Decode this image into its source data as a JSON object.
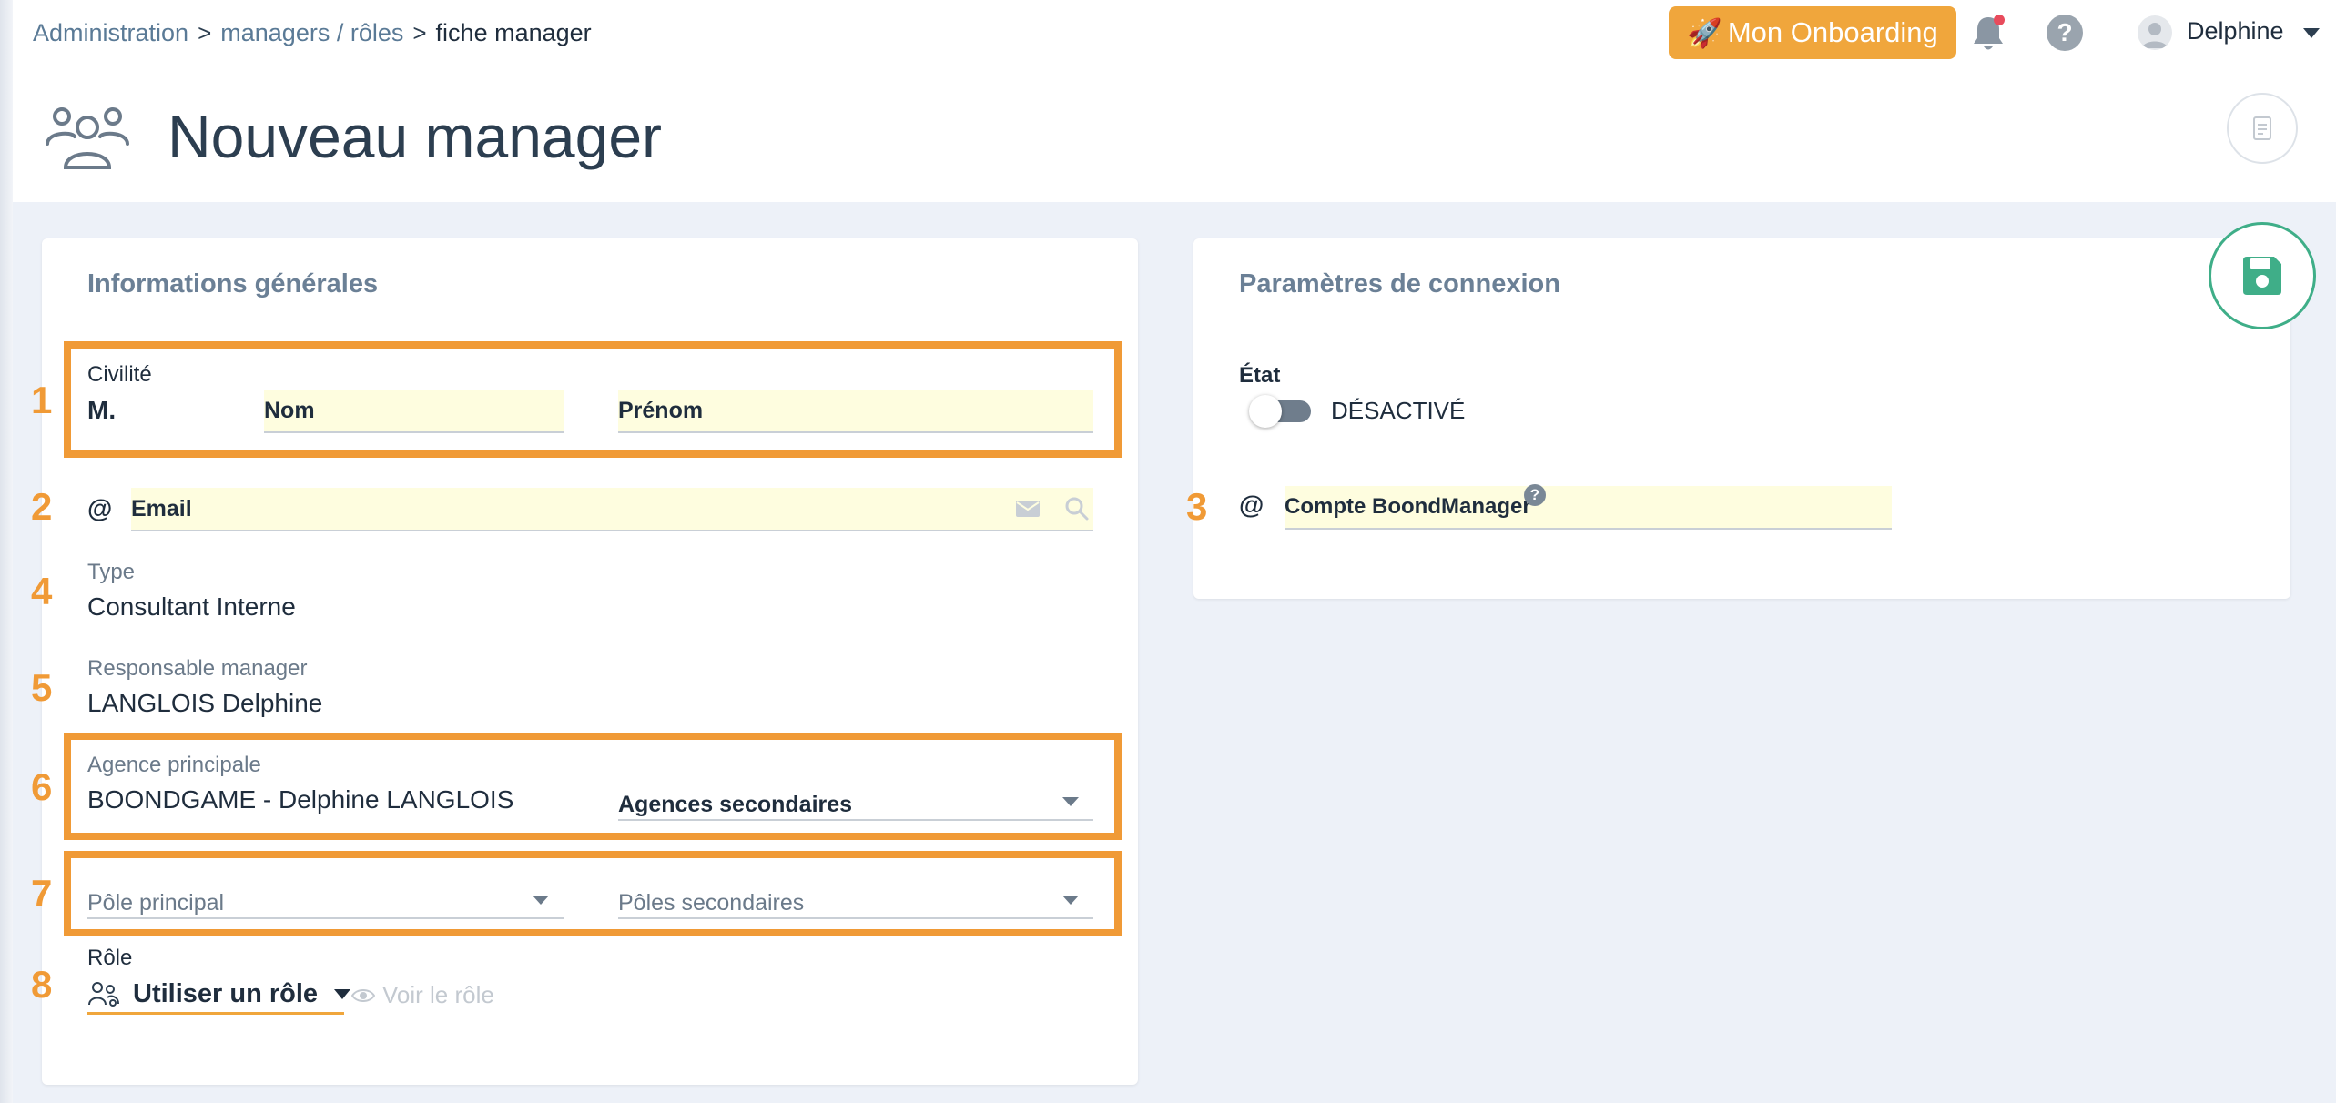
{
  "breadcrumb": {
    "items": [
      "Administration",
      "managers / rôles"
    ],
    "current": "fiche manager",
    "separator": ">"
  },
  "header": {
    "onboarding_label": "Mon Onboarding",
    "onboarding_emoji": "🚀",
    "help_label": "?",
    "user_name": "Delphine",
    "title": "Nouveau manager"
  },
  "general": {
    "title": "Informations générales",
    "civilite_label": "Civilité",
    "civilite_value": "M.",
    "nom_label": "Nom",
    "prenom_label": "Prénom",
    "email_symbol": "@",
    "email_label": "Email",
    "type_label": "Type",
    "type_value": "Consultant Interne",
    "responsable_label": "Responsable manager",
    "responsable_value": "LANGLOIS Delphine",
    "agence_label": "Agence principale",
    "agence_value": "BOONDGAME - Delphine LANGLOIS",
    "agences_secondaires_label": "Agences secondaires",
    "pole_principal_label": "Pôle principal",
    "poles_secondaires_label": "Pôles secondaires",
    "role_label": "Rôle",
    "role_value": "Utiliser un rôle",
    "voir_role_label": "Voir le rôle"
  },
  "connexion": {
    "title": "Paramètres de connexion",
    "etat_label": "État",
    "etat_value": "DÉSACTIVÉ",
    "compte_symbol": "@",
    "compte_label": "Compte BoondManager",
    "help_label": "?"
  },
  "annotations": [
    "1",
    "2",
    "3",
    "4",
    "5",
    "6",
    "7",
    "8"
  ],
  "colors": {
    "accent_orange": "#f09a36",
    "onboarding": "#f0a63c",
    "save_green": "#3fae88",
    "input_yellow": "#fefddf",
    "card_title": "#6b8096"
  }
}
